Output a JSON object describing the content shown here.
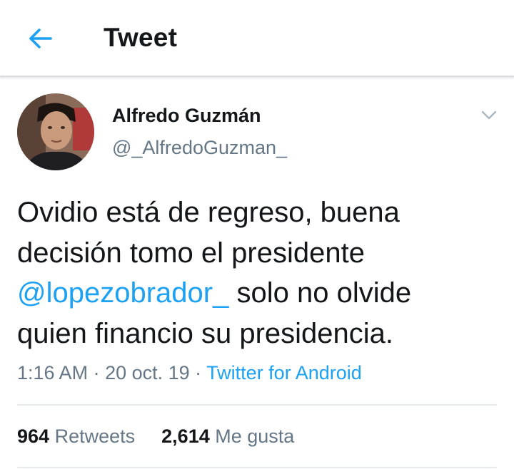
{
  "header": {
    "title": "Tweet",
    "back_icon": "arrow-left-icon",
    "accent_color": "#1da1f2"
  },
  "tweet": {
    "author": {
      "name": "Alfredo Guzmán",
      "handle": "@_AlfredoGuzman_"
    },
    "text": {
      "line1": "Ovidio está de regreso, buena",
      "line2": "decisión tomo el presidente",
      "mention": "@lopezobrador_",
      "line3_rest": " solo no olvide",
      "line4": "quien financio su presidencia."
    },
    "time": "1:16 AM",
    "date": "20 oct. 19",
    "separator": " · ",
    "source": "Twitter for Android",
    "stats": {
      "retweets_count": "964",
      "retweets_label": " Retweets",
      "likes_count": "2,614",
      "likes_label": " Me gusta"
    }
  },
  "colors": {
    "text_primary": "#14171a",
    "text_secondary": "#657786",
    "link": "#1da1f2",
    "divider": "#e6ecf0"
  }
}
